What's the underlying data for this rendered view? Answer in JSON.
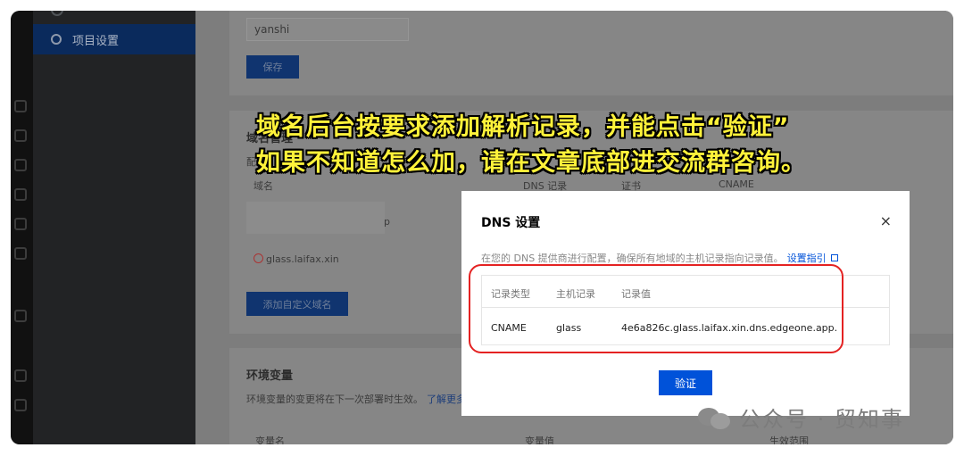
{
  "sidebar": {
    "active_item": "项目设置"
  },
  "project": {
    "name_value": "yanshi",
    "save_label": "保存"
  },
  "domain_section": {
    "title": "域名管理",
    "desc_prefix": "配",
    "desc_link": "了解",
    "columns": [
      "域名",
      "DNS 记录",
      "证书",
      "CNAME"
    ],
    "row_suffix": "p",
    "domain": "glass.laifax.xin",
    "add_button": "添加自定义域名"
  },
  "env_section": {
    "title": "环境变量",
    "desc": "环境变量的变更将在下一次部署时生效。",
    "desc_link": "了解更多",
    "columns": [
      "变量名",
      "变量值",
      "生效范围"
    ]
  },
  "caption": {
    "line1": "域名后台按要求添加解析记录，并能点击“验证”",
    "line2": "如果不知道怎么加，请在文章底部进交流群咨询。"
  },
  "modal": {
    "title": "DNS 设置",
    "close": "×",
    "desc": "在您的 DNS 提供商进行配置，确保所有地域的主机记录指向记录值。",
    "guide_link": "设置指引",
    "columns": [
      "记录类型",
      "主机记录",
      "记录值"
    ],
    "record": {
      "type": "CNAME",
      "host": "glass",
      "value": "4e6a826c.glass.laifax.xin.dns.edgeone.app."
    },
    "verify_label": "验证"
  },
  "watermark": {
    "text": "公众号 · 贸知事"
  }
}
